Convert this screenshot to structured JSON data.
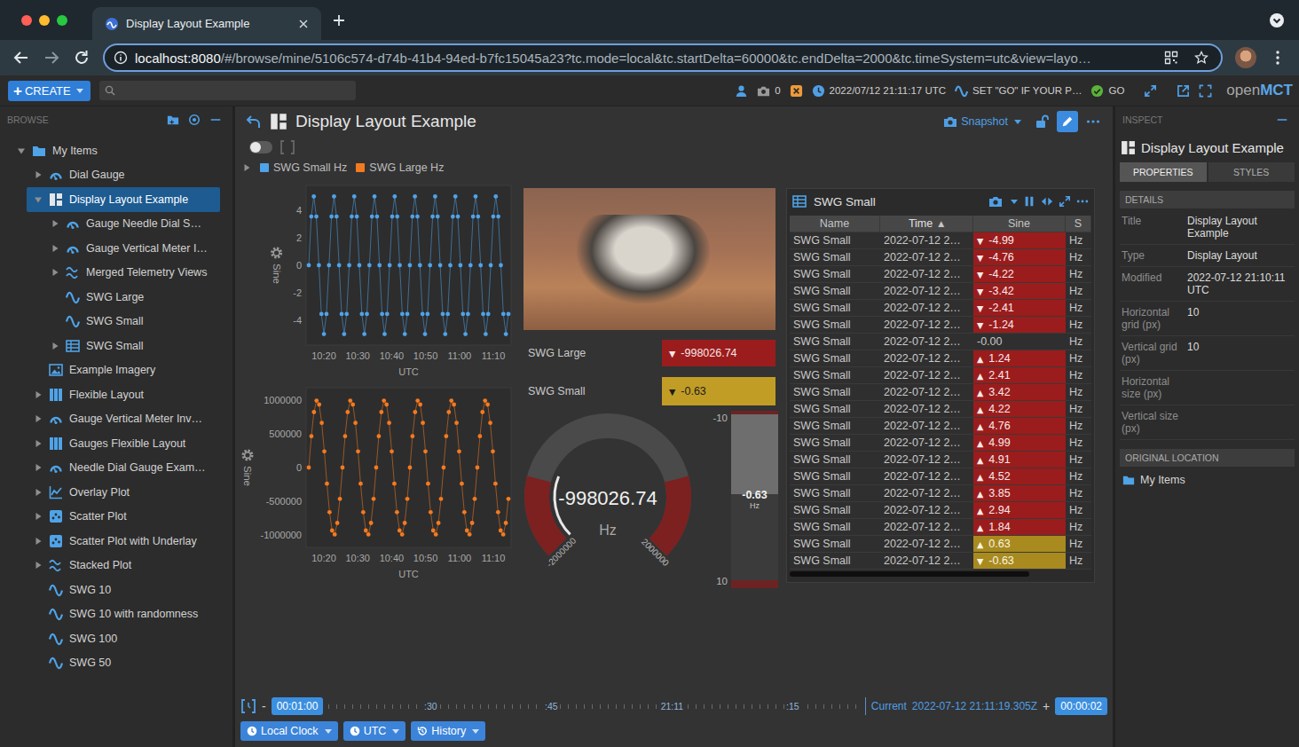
{
  "browser": {
    "tab": {
      "title": "Display Layout Example",
      "selected": true
    },
    "url": {
      "host": "localhost:8080",
      "path": "/#/browse/mine/5106c574-d74b-41b4-94ed-b7fc15045a23?tc.mode=local&tc.startDelta=60000&tc.endDelta=2000&tc.timeSystem=utc&view=layo…"
    }
  },
  "app_header": {
    "create": {
      "icon": "+",
      "label": "CREATE"
    },
    "snapshot_count": "0",
    "clock": "2022/07/12 21:11:17 UTC",
    "go_message": "SET \"GO\" IF YOUR P…",
    "go_label": "GO",
    "logo": {
      "light": "open",
      "bold": "MCT"
    }
  },
  "browse": {
    "title": "BROWSE",
    "tree": [
      {
        "label": "My Items",
        "kind": "folder",
        "expandable": true,
        "expanded": true,
        "selected": false,
        "children": [
          {
            "label": "Dial Gauge",
            "kind": "gauge",
            "expandable": true,
            "expanded": false,
            "selected": false
          },
          {
            "label": "Display Layout Example",
            "kind": "layout",
            "expandable": true,
            "expanded": true,
            "selected": true,
            "children": [
              {
                "label": "Gauge Needle Dial S…",
                "kind": "gauge",
                "expandable": true,
                "expanded": false,
                "selected": false
              },
              {
                "label": "Gauge Vertical Meter I…",
                "kind": "gauge",
                "expandable": true,
                "expanded": false,
                "selected": false
              },
              {
                "label": "Merged Telemetry Views",
                "kind": "stacked",
                "expandable": true,
                "expanded": false,
                "selected": false
              },
              {
                "label": "SWG Large",
                "kind": "telemetry",
                "expandable": false,
                "expanded": false,
                "selected": false
              },
              {
                "label": "SWG Small",
                "kind": "telemetry",
                "expandable": false,
                "expanded": false,
                "selected": false
              },
              {
                "label": "SWG Small",
                "kind": "table",
                "expandable": true,
                "expanded": false,
                "selected": false
              }
            ]
          },
          {
            "label": "Example Imagery",
            "kind": "imagery",
            "expandable": false,
            "expanded": false,
            "selected": false
          },
          {
            "label": "Flexible Layout",
            "kind": "flexible",
            "expandable": true,
            "expanded": false,
            "selected": false
          },
          {
            "label": "Gauge Vertical Meter Inv…",
            "kind": "gauge",
            "expandable": true,
            "expanded": false,
            "selected": false
          },
          {
            "label": "Gauges Flexible Layout",
            "kind": "flexible",
            "expandable": true,
            "expanded": false,
            "selected": false
          },
          {
            "label": "Needle Dial Gauge Exam…",
            "kind": "gauge",
            "expandable": true,
            "expanded": false,
            "selected": false
          },
          {
            "label": "Overlay Plot",
            "kind": "plot",
            "expandable": true,
            "expanded": false,
            "selected": false
          },
          {
            "label": "Scatter Plot",
            "kind": "scatter",
            "expandable": true,
            "expanded": false,
            "selected": false
          },
          {
            "label": "Scatter Plot with Underlay",
            "kind": "scatter",
            "expandable": true,
            "expanded": false,
            "selected": false
          },
          {
            "label": "Stacked Plot",
            "kind": "stacked",
            "expandable": true,
            "expanded": false,
            "selected": false
          },
          {
            "label": "SWG 10",
            "kind": "telemetry",
            "expandable": false,
            "expanded": false,
            "selected": false
          },
          {
            "label": "SWG 10 with randomness",
            "kind": "telemetry",
            "expandable": false,
            "expanded": false,
            "selected": false
          },
          {
            "label": "SWG 100",
            "kind": "telemetry",
            "expandable": false,
            "expanded": false,
            "selected": false
          },
          {
            "label": "SWG 50",
            "kind": "telemetry",
            "expandable": false,
            "expanded": false,
            "selected": false
          }
        ]
      }
    ]
  },
  "object_view": {
    "title": "Display Layout Example",
    "snapshot_label": "Snapshot",
    "frame_toggle": {
      "on": false
    },
    "legend": {
      "expanded": false,
      "items": [
        {
          "label": "SWG Small Hz",
          "color": "#4fa3e8"
        },
        {
          "label": "SWG Large Hz",
          "color": "#f47a20"
        }
      ]
    }
  },
  "layout": {
    "plots": [
      {
        "y_axis_label": "Sine",
        "y_ticks": [
          "4",
          "2",
          "0",
          "-2",
          "-4"
        ],
        "y_range": [
          -5.8,
          5.8
        ],
        "x_ticks": [
          "10:20",
          "10:30",
          "10:40",
          "10:50",
          "11:00",
          "11:10"
        ],
        "x_axis_label": "UTC",
        "color": "#4fa3e8",
        "values": [
          0,
          3.54,
          5,
          3.54,
          0,
          -3.54,
          -5,
          -3.54,
          0,
          3.54,
          5,
          3.54,
          0,
          -3.54,
          -5,
          -3.54,
          0,
          3.54,
          5,
          3.54,
          0,
          -3.54,
          -5,
          -3.54,
          0,
          3.54,
          5,
          3.54,
          0,
          -3.54,
          -5,
          -3.54,
          0,
          3.54,
          5,
          3.54,
          0,
          -3.54,
          -5,
          -3.54,
          0,
          3.54,
          5,
          3.54,
          0,
          -3.54,
          -5,
          -3.54,
          0,
          3.54,
          5,
          3.54,
          0,
          -3.54,
          -5,
          -3.54,
          0,
          3.54,
          5,
          3.54,
          0,
          -3.54,
          -5,
          -3.54,
          0,
          3.54,
          5,
          3.54,
          0,
          -3.54,
          -5,
          -3.54,
          0,
          3.54,
          5,
          3.54,
          0,
          -3.54,
          -5,
          -3.54
        ]
      },
      {
        "y_axis_label": "Sine",
        "y_ticks": [
          "1000000",
          "500000",
          "0",
          "-500000",
          "-1000000"
        ],
        "y_range": [
          -1185000,
          1185000
        ],
        "x_ticks": [
          "10:20",
          "10:30",
          "10:40",
          "10:50",
          "11:00",
          "11:10"
        ],
        "x_axis_label": "UTC",
        "color": "#f47a20",
        "values": [
          0,
          464723,
          822984,
          992709,
          935016,
          663123,
          239316,
          -239316,
          -663123,
          -935016,
          -992709,
          -822984,
          -464723,
          0,
          464723,
          822984,
          992709,
          935016,
          663123,
          239316,
          -239316,
          -663123,
          -935016,
          -992709,
          -822984,
          -464723,
          0,
          464723,
          822984,
          992709,
          935016,
          663123,
          239316,
          -239316,
          -663123,
          -935016,
          -992709,
          -822984,
          -464723,
          0,
          464723,
          822984,
          992709,
          935016,
          663123,
          239316,
          -239316,
          -663123,
          -935016,
          -992709,
          -822984,
          -464723,
          0,
          464723,
          822984,
          992709,
          935016,
          663123,
          239316,
          -239316,
          -663123,
          -935016,
          -992709,
          -822984,
          -464723,
          0,
          464723,
          822984,
          992709,
          935016,
          663123,
          239316,
          -239316,
          -663123,
          -935016,
          -992709,
          -822984,
          -464723
        ]
      }
    ],
    "alphanumerics": [
      {
        "label": "SWG Large",
        "value": "-998026.74",
        "arrow": "▼",
        "limit": "red"
      },
      {
        "label": "SWG Small",
        "value": "-0.63",
        "arrow": "▼",
        "limit": "yellow"
      }
    ],
    "dial": {
      "value": "-998026.74",
      "units": "Hz",
      "min": "-2000000",
      "max": "2000000",
      "level": 0.25,
      "limit_levels": [
        0.22,
        0.78
      ]
    },
    "meter": {
      "value": "-0.63",
      "units": "Hz",
      "top": "-10",
      "bottom": "10",
      "level": 0.47,
      "limit_levels": [
        0.02,
        0.955
      ]
    },
    "table": {
      "title": "SWG Small",
      "columns": [
        {
          "label": "Name",
          "sorted": false,
          "sort_arrow": ""
        },
        {
          "label": "Time",
          "sorted": true,
          "sort_arrow": "▲"
        },
        {
          "label": "Sine",
          "sorted": false,
          "sort_arrow": ""
        },
        {
          "label": "S",
          "sorted": false,
          "sort_arrow": ""
        }
      ],
      "rows": [
        {
          "name": "SWG Small",
          "time": "2022-07-12 2…",
          "sine": "-4.99",
          "arrow": "▼",
          "units": "Hz",
          "limit": "red"
        },
        {
          "name": "SWG Small",
          "time": "2022-07-12 2…",
          "sine": "-4.76",
          "arrow": "▼",
          "units": "Hz",
          "limit": "red"
        },
        {
          "name": "SWG Small",
          "time": "2022-07-12 2…",
          "sine": "-4.22",
          "arrow": "▼",
          "units": "Hz",
          "limit": "red"
        },
        {
          "name": "SWG Small",
          "time": "2022-07-12 2…",
          "sine": "-3.42",
          "arrow": "▼",
          "units": "Hz",
          "limit": "red"
        },
        {
          "name": "SWG Small",
          "time": "2022-07-12 2…",
          "sine": "-2.41",
          "arrow": "▼",
          "units": "Hz",
          "limit": "red"
        },
        {
          "name": "SWG Small",
          "time": "2022-07-12 2…",
          "sine": "-1.24",
          "arrow": "▼",
          "units": "Hz",
          "limit": "red"
        },
        {
          "name": "SWG Small",
          "time": "2022-07-12 2…",
          "sine": "-0.00",
          "arrow": "",
          "units": "Hz",
          "limit": "none"
        },
        {
          "name": "SWG Small",
          "time": "2022-07-12 2…",
          "sine": "1.24",
          "arrow": "▲",
          "units": "Hz",
          "limit": "red"
        },
        {
          "name": "SWG Small",
          "time": "2022-07-12 2…",
          "sine": "2.41",
          "arrow": "▲",
          "units": "Hz",
          "limit": "red"
        },
        {
          "name": "SWG Small",
          "time": "2022-07-12 2…",
          "sine": "3.42",
          "arrow": "▲",
          "units": "Hz",
          "limit": "red"
        },
        {
          "name": "SWG Small",
          "time": "2022-07-12 2…",
          "sine": "4.22",
          "arrow": "▲",
          "units": "Hz",
          "limit": "red"
        },
        {
          "name": "SWG Small",
          "time": "2022-07-12 2…",
          "sine": "4.76",
          "arrow": "▲",
          "units": "Hz",
          "limit": "red"
        },
        {
          "name": "SWG Small",
          "time": "2022-07-12 2…",
          "sine": "4.99",
          "arrow": "▲",
          "units": "Hz",
          "limit": "red"
        },
        {
          "name": "SWG Small",
          "time": "2022-07-12 2…",
          "sine": "4.91",
          "arrow": "▲",
          "units": "Hz",
          "limit": "red"
        },
        {
          "name": "SWG Small",
          "time": "2022-07-12 2…",
          "sine": "4.52",
          "arrow": "▲",
          "units": "Hz",
          "limit": "red"
        },
        {
          "name": "SWG Small",
          "time": "2022-07-12 2…",
          "sine": "3.85",
          "arrow": "▲",
          "units": "Hz",
          "limit": "red"
        },
        {
          "name": "SWG Small",
          "time": "2022-07-12 2…",
          "sine": "2.94",
          "arrow": "▲",
          "units": "Hz",
          "limit": "red"
        },
        {
          "name": "SWG Small",
          "time": "2022-07-12 2…",
          "sine": "1.84",
          "arrow": "▲",
          "units": "Hz",
          "limit": "red"
        },
        {
          "name": "SWG Small",
          "time": "2022-07-12 2…",
          "sine": "0.63",
          "arrow": "▲",
          "units": "Hz",
          "limit": "yellow"
        },
        {
          "name": "SWG Small",
          "time": "2022-07-12 2…",
          "sine": "-0.63",
          "arrow": "▼",
          "units": "Hz",
          "limit": "yellow"
        }
      ]
    }
  },
  "time_conductor": {
    "minus": "-",
    "start_offset": "00:01:00",
    "ticks": [
      ":30",
      ":45",
      "21:11",
      ":15"
    ],
    "current_label": "Current",
    "current_time": "2022-07-12 21:11:19.305Z",
    "plus": "+",
    "end_offset": "00:00:02",
    "menus": [
      {
        "label": "Local Clock",
        "icon": "clock"
      },
      {
        "label": "UTC",
        "icon": "clock"
      },
      {
        "label": "History",
        "icon": "history"
      }
    ]
  },
  "inspect": {
    "title": "INSPECT",
    "object_title": "Display Layout Example",
    "tabs": [
      {
        "label": "PROPERTIES",
        "selected": true
      },
      {
        "label": "STYLES",
        "selected": false
      }
    ],
    "details_heading": "DETAILS",
    "details": [
      {
        "label": "Title",
        "value": "Display Layout Example"
      },
      {
        "label": "Type",
        "value": "Display Layout"
      },
      {
        "label": "Modified",
        "value": "2022-07-12 21:10:11 UTC"
      },
      {
        "label": "Horizontal grid (px)",
        "value": "10"
      },
      {
        "label": "Vertical grid (px)",
        "value": "10"
      },
      {
        "label": "Horizontal size (px)",
        "value": ""
      },
      {
        "label": "Vertical size (px)",
        "value": ""
      }
    ],
    "location_heading": "ORIGINAL LOCATION",
    "location": "My Items"
  }
}
